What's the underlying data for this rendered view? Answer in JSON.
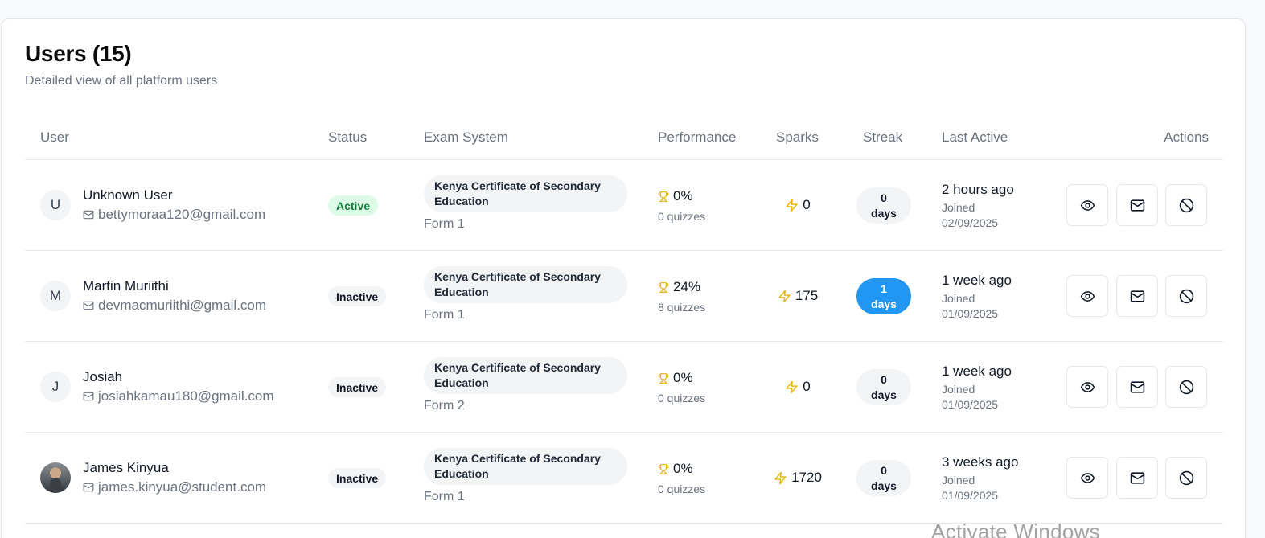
{
  "header": {
    "title": "Users (15)",
    "subtitle": "Detailed view of all platform users"
  },
  "columns": {
    "user": "User",
    "status": "Status",
    "exam_system": "Exam System",
    "performance": "Performance",
    "sparks": "Sparks",
    "streak": "Streak",
    "last_active": "Last Active",
    "actions": "Actions"
  },
  "users": [
    {
      "initial": "U",
      "avatar": "initial",
      "name": "Unknown User",
      "email": "bettymoraa120@gmail.com",
      "status": "Active",
      "status_variant": "active",
      "exam": "Kenya Certificate of Secondary Education",
      "form": "Form 1",
      "performance": "0%",
      "quizzes": "0 quizzes",
      "sparks": "0",
      "streak_value": "0",
      "streak_unit": "days",
      "streak_variant": "default",
      "last_active": "2 hours ago",
      "joined_label": "Joined",
      "joined_date": "02/09/2025"
    },
    {
      "initial": "M",
      "avatar": "initial",
      "name": "Martin Muriithi",
      "email": "devmacmuriithi@gmail.com",
      "status": "Inactive",
      "status_variant": "inactive",
      "exam": "Kenya Certificate of Secondary Education",
      "form": "Form 1",
      "performance": "24%",
      "quizzes": "8 quizzes",
      "sparks": "175",
      "streak_value": "1",
      "streak_unit": "days",
      "streak_variant": "hot",
      "last_active": "1 week ago",
      "joined_label": "Joined",
      "joined_date": "01/09/2025"
    },
    {
      "initial": "J",
      "avatar": "initial",
      "name": "Josiah",
      "email": "josiahkamau180@gmail.com",
      "status": "Inactive",
      "status_variant": "inactive",
      "exam": "Kenya Certificate of Secondary Education",
      "form": "Form 2",
      "performance": "0%",
      "quizzes": "0 quizzes",
      "sparks": "0",
      "streak_value": "0",
      "streak_unit": "days",
      "streak_variant": "default",
      "last_active": "1 week ago",
      "joined_label": "Joined",
      "joined_date": "01/09/2025"
    },
    {
      "initial": "",
      "avatar": "photo",
      "name": "James Kinyua",
      "email": "james.kinyua@student.com",
      "status": "Inactive",
      "status_variant": "inactive",
      "exam": "Kenya Certificate of Secondary Education",
      "form": "Form 1",
      "performance": "0%",
      "quizzes": "0 quizzes",
      "sparks": "1720",
      "streak_value": "0",
      "streak_unit": "days",
      "streak_variant": "default",
      "last_active": "3 weeks ago",
      "joined_label": "Joined",
      "joined_date": "01/09/2025"
    }
  ],
  "actions": {
    "view_icon": "eye-icon",
    "mail_icon": "mail-icon",
    "ban_icon": "ban-icon"
  },
  "colors": {
    "active_badge_bg": "#dcfce7",
    "active_badge_text": "#15803d",
    "streak_hot": "#2196f3",
    "trophy": "#eab308",
    "spark": "#eab308"
  },
  "watermark": "Activate Windows"
}
